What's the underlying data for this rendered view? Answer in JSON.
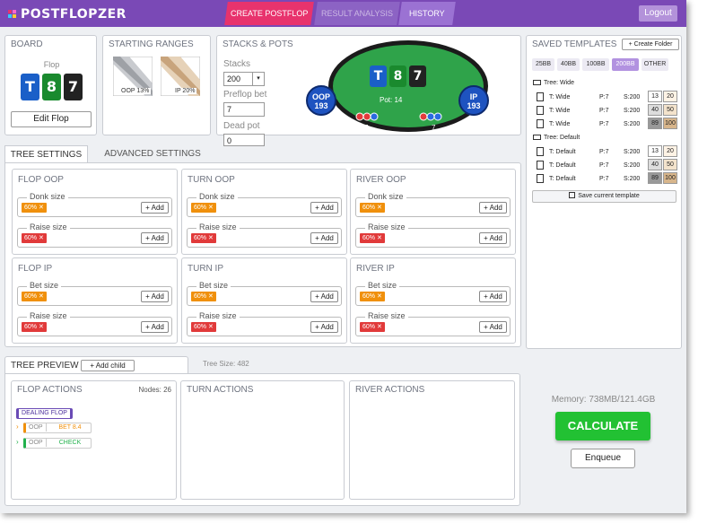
{
  "app": {
    "logo": "POSTFLOPZER",
    "tabs": {
      "create": "CREATE POSTFLOP",
      "result": "RESULT ANALYSIS",
      "history": "HISTORY"
    },
    "logout": "Logout"
  },
  "board": {
    "title": "BOARD",
    "street": "Flop",
    "cards": [
      "T",
      "8",
      "7"
    ],
    "card_colors": [
      "#1a5fc8",
      "#1a8a2e",
      "#222222"
    ],
    "edit_label": "Edit Flop"
  },
  "ranges": {
    "title": "STARTING RANGES",
    "oop_label": "OOP 13%",
    "ip_label": "IP 20%"
  },
  "stacks": {
    "title": "STACKS & POTS",
    "stacks_label": "Stacks",
    "stacks_value": "200",
    "preflop_label": "Preflop bet",
    "preflop_value": "7",
    "dead_label": "Dead pot",
    "dead_value": "0",
    "pot_label": "Pot: 14",
    "oop_name": "OOP",
    "oop_stack": "193",
    "ip_name": "IP",
    "ip_stack": "193",
    "oop_chips": "7",
    "ip_chips": "7"
  },
  "tree_settings": {
    "tab_tree": "TREE SETTINGS",
    "tab_advanced": "ADVANCED SETTINGS",
    "add_label": "+ Add",
    "sections": [
      {
        "title": "FLOP OOP",
        "f1": "Donk size",
        "v1": "60%",
        "f2": "Raise size",
        "v2": "60%"
      },
      {
        "title": "TURN OOP",
        "f1": "Donk size",
        "v1": "60%",
        "f2": "Raise size",
        "v2": "60%"
      },
      {
        "title": "RIVER OOP",
        "f1": "Donk size",
        "v1": "60%",
        "f2": "Raise size",
        "v2": "60%"
      },
      {
        "title": "FLOP IP",
        "f1": "Bet size",
        "v1": "60%",
        "f2": "Raise size",
        "v2": "60%"
      },
      {
        "title": "TURN IP",
        "f1": "Bet size",
        "v1": "60%",
        "f2": "Raise size",
        "v2": "60%"
      },
      {
        "title": "RIVER IP",
        "f1": "Bet size",
        "v1": "60%",
        "f2": "Raise size",
        "v2": "60%"
      }
    ]
  },
  "templates": {
    "title": "SAVED TEMPLATES",
    "create_folder": "+ Create Folder",
    "filters": [
      "25BB",
      "40BB",
      "100BB",
      "200BB",
      "OTHER"
    ],
    "active_filter": "200BB",
    "folders": [
      {
        "name": "Tree: Wide",
        "rows": [
          {
            "name": "T: Wide",
            "p": "P:7",
            "s": "S:200",
            "a": "13",
            "b": "20"
          },
          {
            "name": "T: Wide",
            "p": "P:7",
            "s": "S:200",
            "a": "40",
            "b": "50"
          },
          {
            "name": "T: Wide",
            "p": "P:7",
            "s": "S:200",
            "a": "89",
            "b": "100"
          }
        ]
      },
      {
        "name": "Tree: Default",
        "rows": [
          {
            "name": "T: Default",
            "p": "P:7",
            "s": "S:200",
            "a": "13",
            "b": "20"
          },
          {
            "name": "T: Default",
            "p": "P:7",
            "s": "S:200",
            "a": "40",
            "b": "50"
          },
          {
            "name": "T: Default",
            "p": "P:7",
            "s": "S:200",
            "a": "89",
            "b": "100"
          }
        ]
      }
    ],
    "save_label": "Save current template"
  },
  "preview": {
    "title": "TREE PREVIEW",
    "add_child": "+ Add child",
    "tree_size": "Tree Size: 482",
    "flop_title": "FLOP ACTIONS",
    "nodes": "Nodes: 26",
    "turn_title": "TURN ACTIONS",
    "river_title": "RIVER ACTIONS",
    "dealing": "DEALING FLOP",
    "actions": [
      {
        "player": "OOP",
        "action": "BET 8.4"
      },
      {
        "player": "OOP",
        "action": "CHECK"
      }
    ]
  },
  "calc": {
    "memory": "Memory: 738MB/121.4GB",
    "calculate": "CALCULATE",
    "enqueue": "Enqueue"
  }
}
